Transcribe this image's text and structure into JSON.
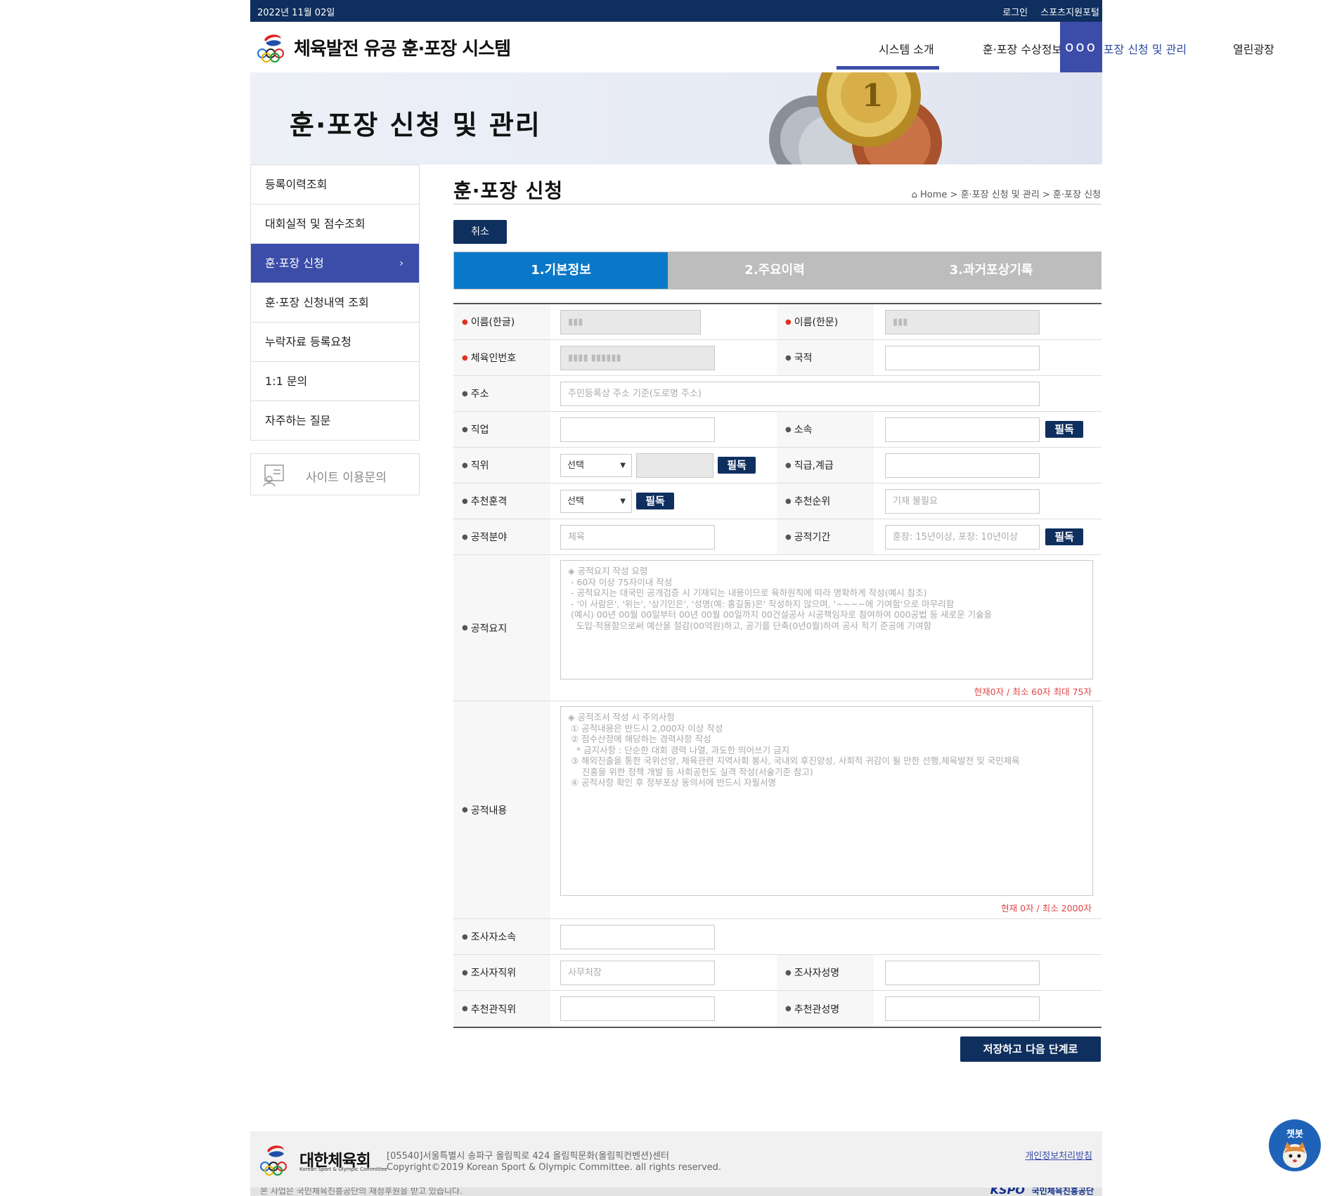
{
  "topbar": {
    "date": "2022년 11월 02일",
    "login": "로그인",
    "portal": "스포츠지원포털"
  },
  "header": {
    "title": "체육발전 유공 훈·포장 시스템",
    "nav": [
      "시스템 소개",
      "훈·포장 수상정보",
      "훈·포장 신청 및 관리",
      "열린광장"
    ],
    "menu_icon": "ooo"
  },
  "banner": {
    "title": "훈·포장 신청 및 관리"
  },
  "sidebar": {
    "items": [
      "등록이력조회",
      "대회실적 및 점수조회",
      "훈·포장 신청",
      "훈·포장 신청내역 조회",
      "누락자료 등록요청",
      "1:1 문의",
      "자주하는 질문"
    ],
    "active_arrow": "›",
    "site_inquiry": "사이트 이용문의"
  },
  "page": {
    "title": "훈·포장 신청",
    "breadcrumb": "Home > 훈·포장 신청 및 관리 > 훈·포장 신청",
    "cancel": "취소",
    "steps": [
      "1.기본정보",
      "2.주요이력",
      "3.과거포상기록"
    ]
  },
  "form": {
    "name_kr": "이름(한글)",
    "name_cn": "이름(한문)",
    "sports_no": "체육인번호",
    "nationality": "국적",
    "address": "주소",
    "address_placeholder": "주민등록상 주소 기준(도로명 주소)",
    "job": "직업",
    "affiliation": "소속",
    "position": "직위",
    "rank": "직급,계급",
    "recommend_grade": "추천훈격",
    "recommend_order": "추천순위",
    "recommend_order_placeholder": "기재 불필요",
    "field": "공적분야",
    "field_placeholder": "체육",
    "period": "공적기간",
    "period_placeholder": "훈장: 15년이상, 포장: 10년이상",
    "select_default": "선택",
    "required_btn": "필독",
    "summary": "공적요지",
    "summary_placeholder": "◈ 공적요지 작성 요령\n - 60자 이상 75자이내 작성\n - 공적요지는 대국민 공개검증 시 기재되는 내용이므로 육하원칙에 따라 명확하게 작성(예시 참조)\n - '이 사람은', '위는', '상기인은', '성명(예: 홍길동)은' 작성하지 않으며, '~~~~에 기여함'으로 마무리함\n (예시) 00년 00월 00일부터 00년 00월 00일까지 00건설공사 시공책임자로 참여하여 000공법 등 새로운 기술을\n   도입·적용함으로써 예산을 절감(00억원)하고, 공기를 단축(0년0월)하여 공사 적기 준공에 기여함",
    "summary_counter": "현재0자 / 최소 60자 최대 75자",
    "content": "공적내용",
    "content_placeholder": "◈ 공적조서 작성 시 주의사항\n ① 공적내용은 반드시 2,000자 이상 작성\n ② 점수산정에 해당하는 경력사항 작성\n   * 금지사항 : 단순한 대회 경력 나열, 과도한 띄어쓰기 금지\n ③ 해외진출을 통한 국위선양, 체육관련 지역사회 봉사, 국내외 후진양성, 사회적 귀감이 될 만한 선행,체육발전 및 국민체육\n     진흥을 위한 정책 개발 등 사회공헌도 실격 작성(서술기준 참고)\n ④ 공적사항 확인 후 정부포상 동의서에 반드시 자필서명",
    "content_counter": "현재 0자 / 최소 2000자",
    "investigator_org": "조사자소속",
    "investigator_position": "조사자직위",
    "investigator_position_placeholder": "사무처장",
    "investigator_name": "조사자성명",
    "recommender_position": "추천관직위",
    "recommender_name": "추천관성명",
    "save_next": "저장하고 다음 단계로"
  },
  "footer": {
    "org": "대한체육회",
    "org_en": "Korean Sport & Olympic Committee",
    "address": "[05540]서울특별시 송파구 올림픽로 424 올림픽문화(올림픽컨벤션)센터",
    "copyright": "Copyright©2019 Korean Sport & Olympic Committee. all rights reserved.",
    "privacy": "개인정보처리방침",
    "funding": "본 사업은 국민체육진흥공단의 재정후원을 받고 있습니다.",
    "kspo": "KSPO",
    "kspo_name": "국민체육진흥공단"
  },
  "chatbot": {
    "label": "챗봇"
  },
  "colors": {
    "navy": "#0f2f5e",
    "accent": "#3b4da8",
    "step_active": "#0a78c8",
    "required_dot": "#dd3322",
    "counter": "#e04545"
  }
}
